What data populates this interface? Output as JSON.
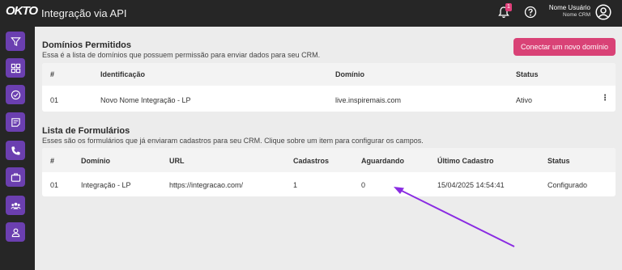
{
  "header": {
    "logo": "OKTO",
    "title": "Integração via API",
    "notification_count": "1",
    "user_name": "Nome Usuário",
    "user_sub": "Nome CRM"
  },
  "sidebar": {
    "items": [
      {
        "icon": "filter-icon"
      },
      {
        "icon": "dashboard-icon"
      },
      {
        "icon": "check-circle-icon"
      },
      {
        "icon": "note-icon"
      },
      {
        "icon": "phone-icon"
      },
      {
        "icon": "briefcase-icon"
      },
      {
        "icon": "team-icon"
      },
      {
        "icon": "user-icon"
      }
    ]
  },
  "domains": {
    "title": "Domínios Permitidos",
    "description": "Essa é a lista de domínios que possuem permissão para enviar dados para seu CRM.",
    "connect_label": "Conectar um novo domínio",
    "columns": [
      "#",
      "Identificação",
      "Domínio",
      "Status"
    ],
    "rows": [
      {
        "num": "01",
        "id": "Novo Nome Integração - LP",
        "domain": "live.inspiremais.com",
        "status": "Ativo"
      }
    ]
  },
  "forms": {
    "title": "Lista de Formulários",
    "description": "Esses são os formulários que já enviaram cadastros para seu CRM. Clique sobre um item para configurar os campos.",
    "columns": [
      "#",
      "Domínio",
      "URL",
      "Cadastros",
      "Aguardando",
      "Último Cadastro",
      "Status"
    ],
    "rows": [
      {
        "num": "01",
        "domain": "Integração - LP",
        "url": "https://integracao.com/",
        "cadastros": "1",
        "aguardando": "0",
        "ultimo": "15/04/2025 14:54:41",
        "status": "Configurado"
      }
    ]
  },
  "colors": {
    "accent_pink": "#d94276",
    "sidebar_purple": "#6b3fb0",
    "annotation_arrow": "#8a2be2"
  }
}
